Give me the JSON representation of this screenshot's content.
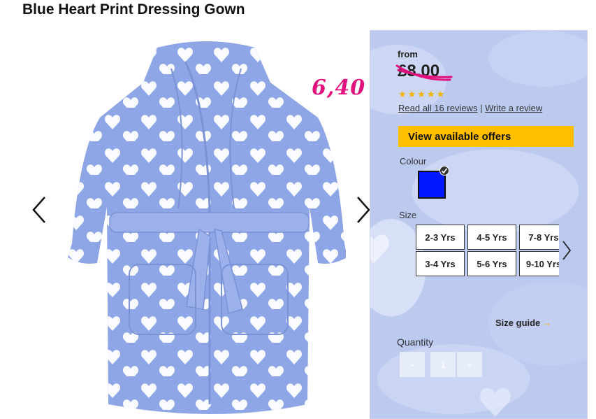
{
  "product": {
    "title": "Blue Heart Print Dressing Gown"
  },
  "gallery": {
    "prev_icon": "chevron-left-icon",
    "next_icon": "chevron-right-icon"
  },
  "annotation": {
    "handwritten_price": "6,40",
    "color": "#e0117c"
  },
  "pricing": {
    "from_label": "from",
    "price": "£8.00",
    "strike_color": "#e0117c"
  },
  "rating": {
    "stars": "★★★★★",
    "star_count": 5,
    "star_color": "#f3b300"
  },
  "reviews": {
    "read_label": "Read all 16 reviews",
    "separator": "|",
    "write_label": "Write a review"
  },
  "offers_button": {
    "label": "View available offers",
    "color": "#ffbf00"
  },
  "colour": {
    "label": "Colour",
    "selected_swatch": "#0018ff"
  },
  "size": {
    "label": "Size",
    "options": [
      "2-3 Yrs",
      "4-5 Yrs",
      "7-8 Yrs",
      "3-4 Yrs",
      "5-6 Yrs",
      "9-10 Yrs"
    ],
    "next_icon": "chevron-right-icon"
  },
  "size_guide": {
    "label": "Size guide",
    "arrow": "→"
  },
  "quantity": {
    "label": "Quantity",
    "minus": "-",
    "value": "1",
    "plus": "+"
  }
}
